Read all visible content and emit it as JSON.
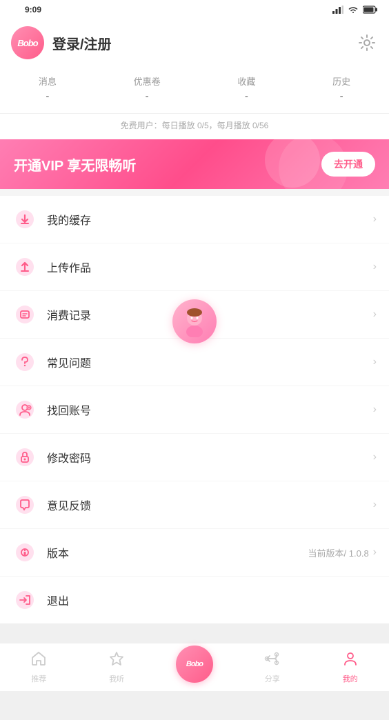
{
  "statusBar": {
    "time": "9:09",
    "icons": [
      "signal",
      "wifi",
      "battery"
    ]
  },
  "header": {
    "logo": "Bobo",
    "title": "登录/注册",
    "settingsLabel": "设置"
  },
  "stats": [
    {
      "label": "消息",
      "value": "-"
    },
    {
      "label": "优惠卷",
      "value": "-"
    },
    {
      "label": "收藏",
      "value": "-"
    },
    {
      "label": "历史",
      "value": "-"
    }
  ],
  "freeHint": "免费用户：每日播放 0/5，每月播放 0/56",
  "vip": {
    "text": "开通VIP 享无限畅听",
    "btnLabel": "去开通"
  },
  "menuItems": [
    {
      "icon": "⬇️",
      "label": "我的缓存",
      "value": "",
      "hasChevron": true
    },
    {
      "icon": "⬆️",
      "label": "上传作品",
      "value": "",
      "hasChevron": true
    },
    {
      "icon": "🧾",
      "label": "消费记录",
      "value": "",
      "hasChevron": true
    },
    {
      "icon": "💬",
      "label": "常见问题",
      "value": "",
      "hasChevron": true
    },
    {
      "icon": "🔍",
      "label": "找回账号",
      "value": "",
      "hasChevron": true
    },
    {
      "icon": "🔒",
      "label": "修改密码",
      "value": "",
      "hasChevron": true
    },
    {
      "icon": "💌",
      "label": "意见反馈",
      "value": "",
      "hasChevron": true
    },
    {
      "icon": "ℹ️",
      "label": "版本",
      "value": "当前版本/ 1.0.8",
      "hasChevron": true
    },
    {
      "icon": "🚪",
      "label": "退出",
      "value": "",
      "hasChevron": false
    }
  ],
  "bottomNav": [
    {
      "icon": "🏠",
      "label": "推荐",
      "active": false
    },
    {
      "icon": "☆",
      "label": "我听",
      "active": false
    },
    {
      "icon": "Bobo",
      "label": "",
      "active": false,
      "isCenter": true
    },
    {
      "icon": "✉",
      "label": "分享",
      "active": false
    },
    {
      "icon": "😊",
      "label": "我的",
      "active": true
    }
  ]
}
